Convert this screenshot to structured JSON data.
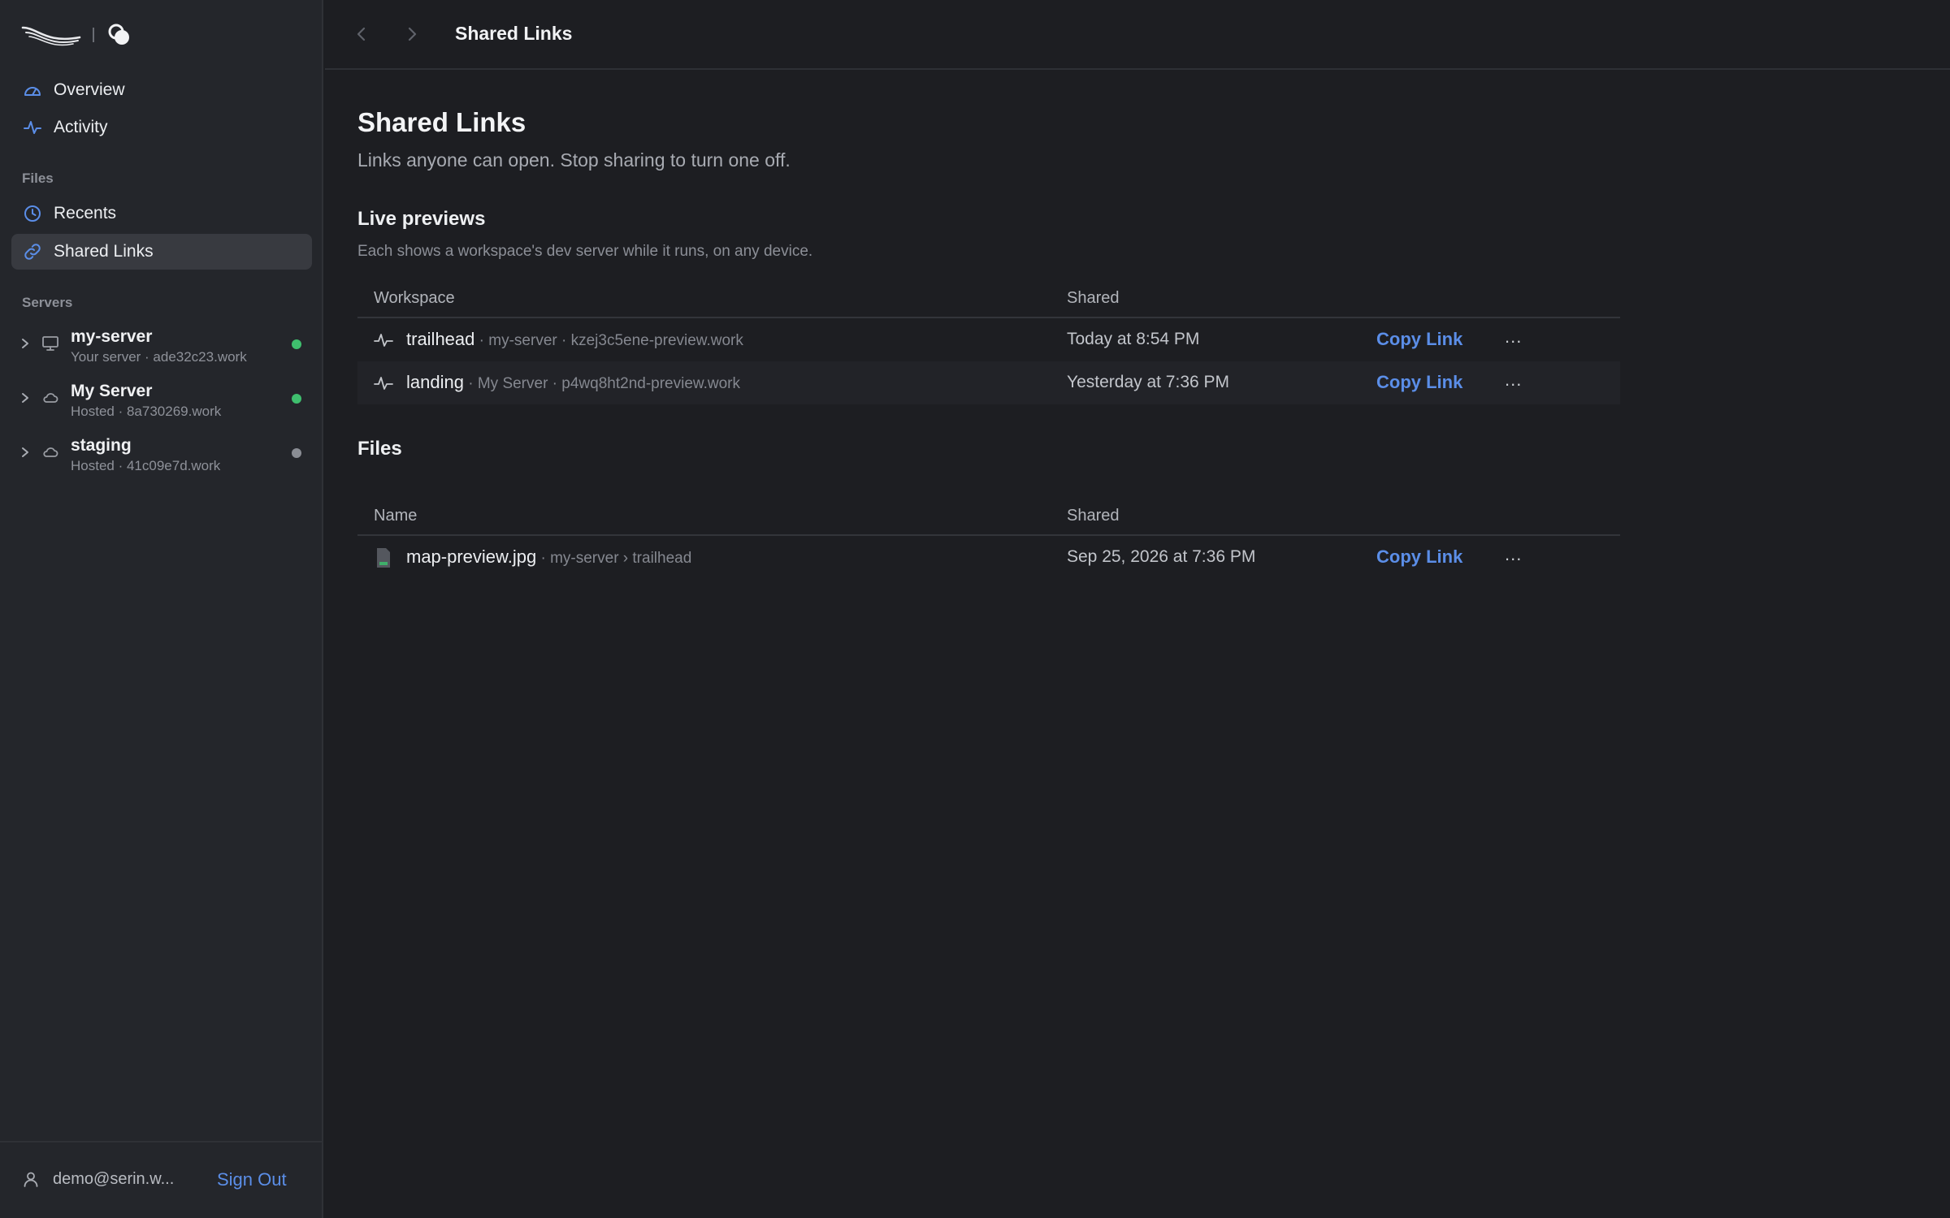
{
  "sidebar": {
    "nav": [
      {
        "label": "Overview",
        "icon": "gauge-icon"
      },
      {
        "label": "Activity",
        "icon": "activity-icon"
      }
    ],
    "files_label": "Files",
    "files_nav": [
      {
        "label": "Recents",
        "icon": "clock-icon"
      },
      {
        "label": "Shared Links",
        "icon": "link-icon",
        "active": true
      }
    ],
    "servers_label": "Servers",
    "servers": [
      {
        "name": "my-server",
        "sub": "Your server · ade32c23.work",
        "icon": "monitor-icon",
        "status": "online"
      },
      {
        "name": "My Server",
        "sub": "Hosted · 8a730269.work",
        "icon": "cloud-icon",
        "status": "online"
      },
      {
        "name": "staging",
        "sub": "Hosted · 41c09e7d.work",
        "icon": "cloud-icon",
        "status": "offline"
      }
    ],
    "user_email": "demo@serin.w...",
    "sign_out": "Sign Out"
  },
  "topbar": {
    "title": "Shared Links"
  },
  "page": {
    "title": "Shared Links",
    "subtitle": "Links anyone can open. Stop sharing to turn one off."
  },
  "live": {
    "title": "Live previews",
    "description": "Each shows a workspace's dev server while it runs, on any device.",
    "col_workspace": "Workspace",
    "col_shared": "Shared",
    "rows": [
      {
        "name": "trailhead",
        "meta": " · my-server · kzej3c5ene-preview.work",
        "shared": "Today at 8:54 PM",
        "copy": "Copy Link",
        "more": "..."
      },
      {
        "name": "landing",
        "meta": " · My Server · p4wq8ht2nd-preview.work",
        "shared": "Yesterday at 7:36 PM",
        "copy": "Copy Link",
        "more": "..."
      }
    ]
  },
  "files": {
    "title": "Files",
    "col_name": "Name",
    "col_shared": "Shared",
    "rows": [
      {
        "name": "map-preview.jpg",
        "meta": " · my-server › trailhead",
        "shared": "Sep 25, 2026 at 7:36 PM",
        "copy": "Copy Link",
        "more": "..."
      }
    ]
  },
  "colors": {
    "accent": "#5b8ee8",
    "online": "#3fbf6e",
    "offline": "#8a8d94"
  }
}
